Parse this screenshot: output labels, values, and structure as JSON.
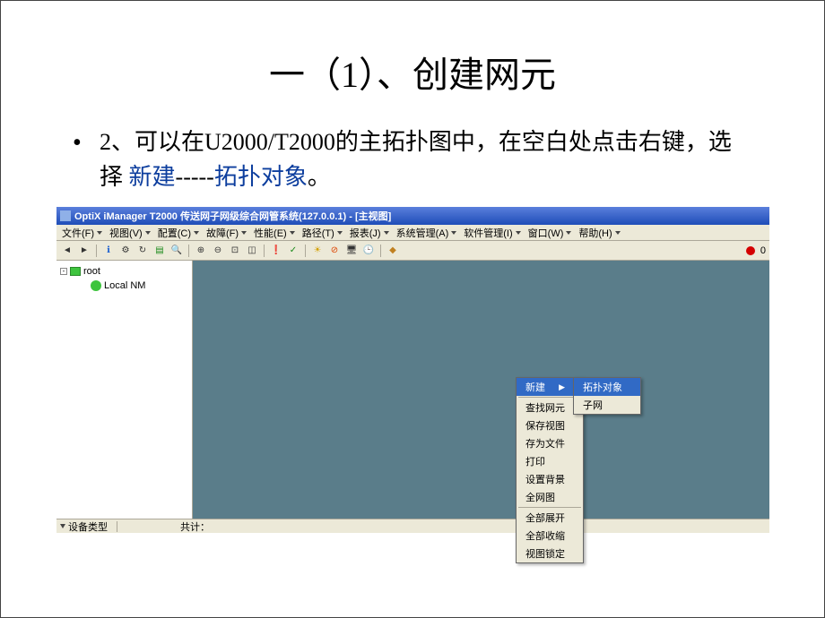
{
  "slide": {
    "title": "一（1）、创建网元",
    "bullet_prefix": "2、可以在U2000/T2000的主拓扑图中，在空白处点击右键，选择 ",
    "hl1": "新建",
    "dashes": "-----",
    "hl2": "拓扑对象",
    "period": "。"
  },
  "app": {
    "window_title": "OptiX iManager T2000 传送网子网级综合网管系统(127.0.0.1) - [主视图]",
    "menubar": [
      "文件(F)",
      "视图(V)",
      "配置(C)",
      "故障(F)",
      "性能(E)",
      "路径(T)",
      "报表(J)",
      "系统管理(A)",
      "软件管理(I)",
      "窗口(W)",
      "帮助(H)"
    ],
    "indicator_value": "0",
    "tree": {
      "root": "root",
      "child": "Local NM"
    },
    "context_menu": {
      "items_top": [
        "新建"
      ],
      "items_mid": [
        "查找网元",
        "保存视图",
        "存为文件",
        "打印",
        "设置背景",
        "全网图"
      ],
      "items_bot": [
        "全部展开",
        "全部收缩",
        "视图锁定"
      ]
    },
    "sub_menu": {
      "highlighted": "拓扑对象",
      "items": [
        "子网"
      ]
    },
    "bottom": {
      "tab": "设备类型",
      "total_label": "共计："
    }
  }
}
